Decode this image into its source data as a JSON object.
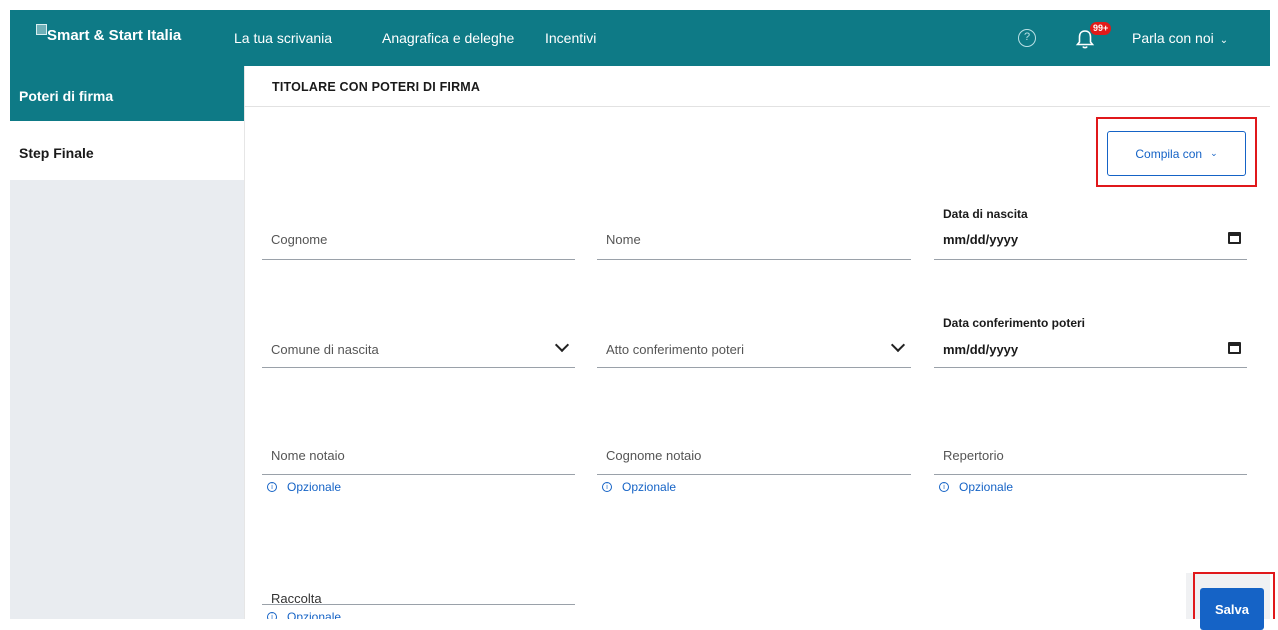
{
  "header": {
    "brand": "Smart & Start Italia",
    "nav": [
      "La tua scrivania",
      "Anagrafica e deleghe",
      "Incentivi"
    ],
    "help_icon": "question-circle-icon",
    "notifications_icon": "bell-icon",
    "notifications_badge": "99+",
    "talk_label": "Parla con noi",
    "background_color": "#0e7a86"
  },
  "sidebar": {
    "items": [
      {
        "label": "Poteri di firma",
        "active": true
      },
      {
        "label": "Step Finale",
        "active": false
      }
    ]
  },
  "form": {
    "section_title": "TITOLARE CON POTERI DI FIRMA",
    "compila_label": "Compila con",
    "optional_hint": "Opzionale",
    "fields": {
      "cognome": {
        "placeholder": "Cognome"
      },
      "nome": {
        "placeholder": "Nome"
      },
      "data_nascita": {
        "label": "Data di nascita",
        "value": "mm/dd/yyyy"
      },
      "comune_nascita": {
        "placeholder": "Comune di nascita"
      },
      "atto_conferimento": {
        "placeholder": "Atto conferimento poteri"
      },
      "data_conferimento": {
        "label": "Data conferimento poteri",
        "value": "mm/dd/yyyy"
      },
      "nome_notaio": {
        "placeholder": "Nome notaio"
      },
      "cognome_notaio": {
        "placeholder": "Cognome notaio"
      },
      "repertorio": {
        "placeholder": "Repertorio"
      },
      "raccolta": {
        "placeholder": "Raccolta"
      }
    },
    "save_label": "Salva",
    "accent_color": "#1563c6",
    "highlight_color": "#e0181b"
  }
}
